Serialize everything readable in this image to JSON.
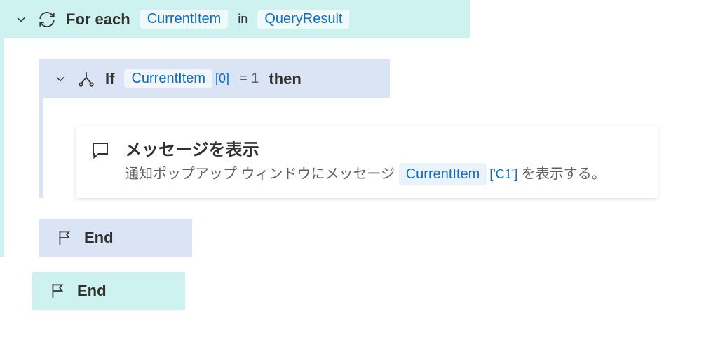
{
  "foreach": {
    "keyword": "For each",
    "var": "CurrentItem",
    "in": "in",
    "source": "QueryResult"
  },
  "if": {
    "keyword": "If",
    "cond_var": "CurrentItem",
    "cond_index": "[0]",
    "cond_op": "= 1",
    "then": "then"
  },
  "action": {
    "title": "メッセージを表示",
    "desc_pre": "通知ポップアップ ウィンドウにメッセージ ",
    "desc_var": "CurrentItem",
    "desc_index": "['C1']",
    "desc_post": " を表示する。"
  },
  "end_if": "End",
  "end_foreach": "End"
}
